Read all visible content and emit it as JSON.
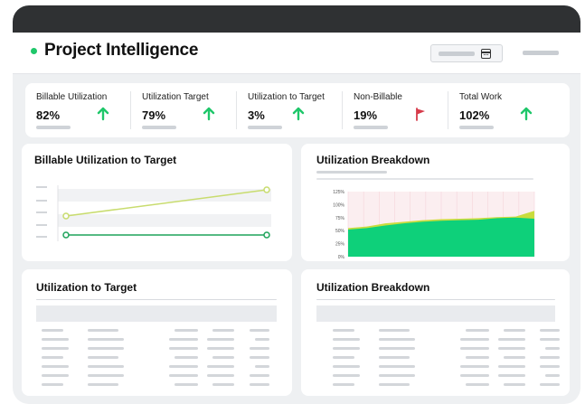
{
  "app": {
    "title": "Project Intelligence"
  },
  "colors": {
    "accent": "#1fc76a",
    "flag": "#d63b4a",
    "chart_line_target": "#c8dc6e",
    "chart_line_actual": "#1ea35a",
    "area_fill": "#0ed07a",
    "area_top": "#c9dc3d"
  },
  "kpis": [
    {
      "label": "Billable Utilization",
      "value": "82%",
      "icon": "arrow-up-icon"
    },
    {
      "label": "Utilization Target",
      "value": "79%",
      "icon": "arrow-up-icon"
    },
    {
      "label": "Utilization to Target",
      "value": "3%",
      "icon": "arrow-up-icon"
    },
    {
      "label": "Non-Billable",
      "value": "19%",
      "icon": "flag-icon"
    },
    {
      "label": "Total Work",
      "value": "102%",
      "icon": "arrow-up-icon"
    }
  ],
  "cards": {
    "billable_chart_title": "Billable Utilization to Target",
    "breakdown_chart_title": "Utilization Breakdown",
    "util_table_title": "Utilization to Target",
    "breakdown_table_title": "Utilization Breakdown"
  },
  "chart_data": {
    "type": "area",
    "title": "Utilization Breakdown",
    "y_ticks": [
      "125%",
      "100%",
      "75%",
      "50%",
      "25%",
      "0%"
    ],
    "ylim": [
      0,
      125
    ],
    "x": [
      0,
      1,
      2,
      3,
      4,
      5,
      6,
      7,
      8,
      9,
      10
    ],
    "series": [
      {
        "values": [
          52,
          55,
          60,
          64,
          67,
          69,
          70,
          71,
          74,
          75,
          73
        ]
      },
      {
        "values": [
          55,
          58,
          64,
          67,
          70,
          72,
          73,
          74,
          76,
          77,
          88
        ]
      }
    ],
    "grid": true
  }
}
